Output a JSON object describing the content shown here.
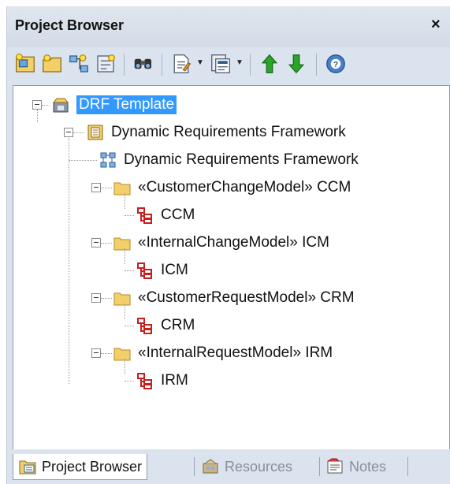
{
  "panel": {
    "title": "Project Browser",
    "close_glyph": "×"
  },
  "toolbar": {
    "buttons": [
      {
        "icon": "new-model-icon"
      },
      {
        "icon": "new-package-icon"
      },
      {
        "icon": "new-diagram-icon"
      },
      {
        "icon": "new-element-icon"
      },
      {
        "icon": "find-icon"
      },
      {
        "icon": "document-icon"
      },
      {
        "icon": "generate-icon"
      },
      {
        "icon": "move-up-icon"
      },
      {
        "icon": "move-down-icon"
      },
      {
        "icon": "help-icon"
      }
    ]
  },
  "tree": {
    "root": {
      "label": "DRF Template",
      "icon": "model-root-icon",
      "selected": true
    },
    "framework": {
      "label": "Dynamic Requirements Framework",
      "icon": "package-icon"
    },
    "framework_diagram": {
      "label": "Dynamic Requirements Framework",
      "icon": "diagram-icon"
    },
    "packages": [
      {
        "label": "«CustomerChangeModel» CCM",
        "child": "CCM"
      },
      {
        "label": "«InternalChangeModel» ICM",
        "child": "ICM"
      },
      {
        "label": "«CustomerRequestModel» CRM",
        "child": "CRM"
      },
      {
        "label": "«InternalRequestModel» IRM",
        "child": "IRM"
      }
    ]
  },
  "tabs": [
    {
      "label": "Project Browser",
      "active": true,
      "icon": "project-browser-icon"
    },
    {
      "label": "Resources",
      "active": false,
      "icon": "resources-icon"
    },
    {
      "label": "Notes",
      "active": false,
      "icon": "notes-icon"
    }
  ],
  "colors": {
    "selection": "#3399ff",
    "panel_bg": "#dbe3ee",
    "arrow_green": "#2aa52a",
    "folder_yellow": "#f3cf6a"
  }
}
